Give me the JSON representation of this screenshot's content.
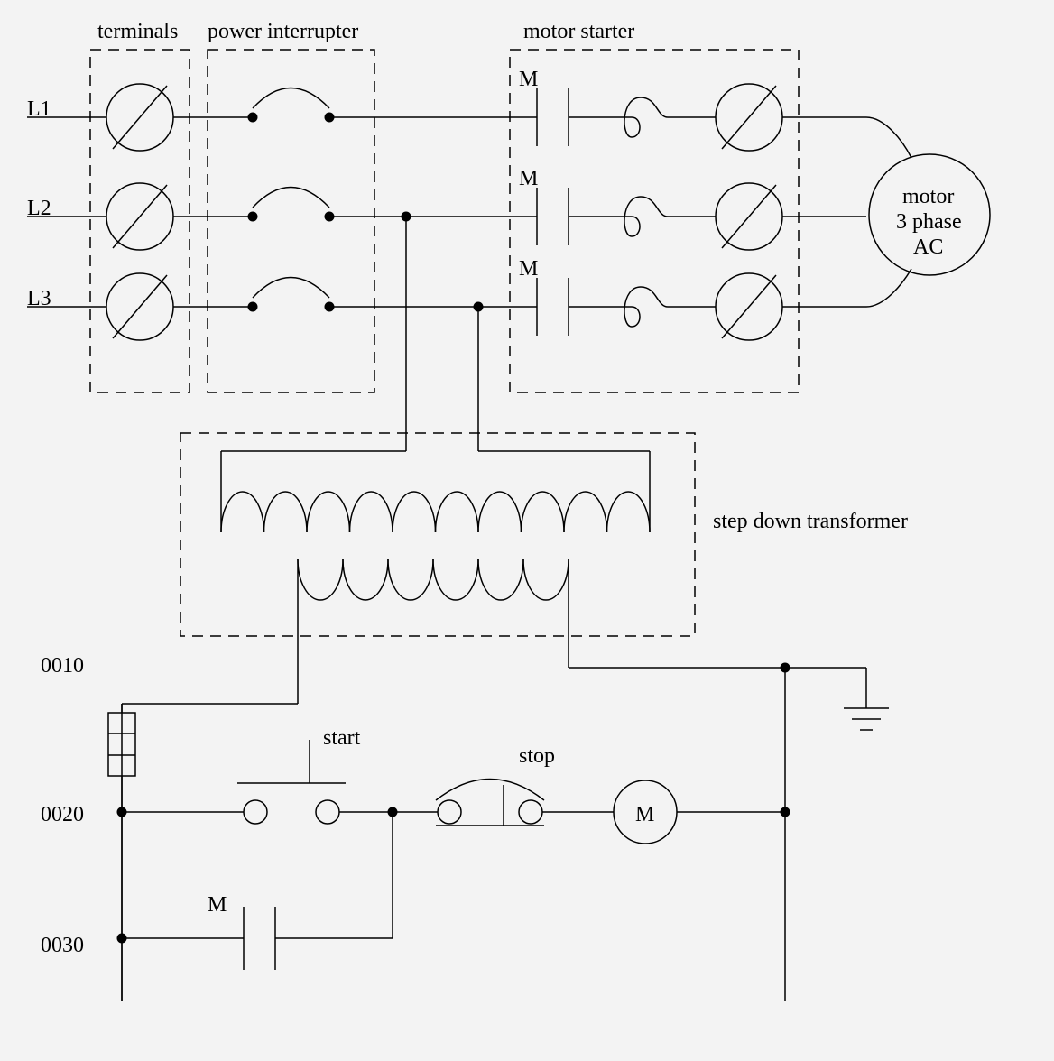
{
  "labels": {
    "terminals": "terminals",
    "power_interrupter": "power interrupter",
    "motor_starter": "motor starter",
    "transformer": "step down transformer",
    "L1": "L1",
    "L2": "L2",
    "L3": "L3",
    "M_top1": "M",
    "M_top2": "M",
    "M_top3": "M",
    "motor_line1": "motor",
    "motor_line2": "3 phase",
    "motor_line3": "AC",
    "rung0010": "0010",
    "rung0020": "0020",
    "rung0030": "0030",
    "start": "start",
    "stop": "stop",
    "coil_M": "M",
    "contact_M": "M"
  }
}
